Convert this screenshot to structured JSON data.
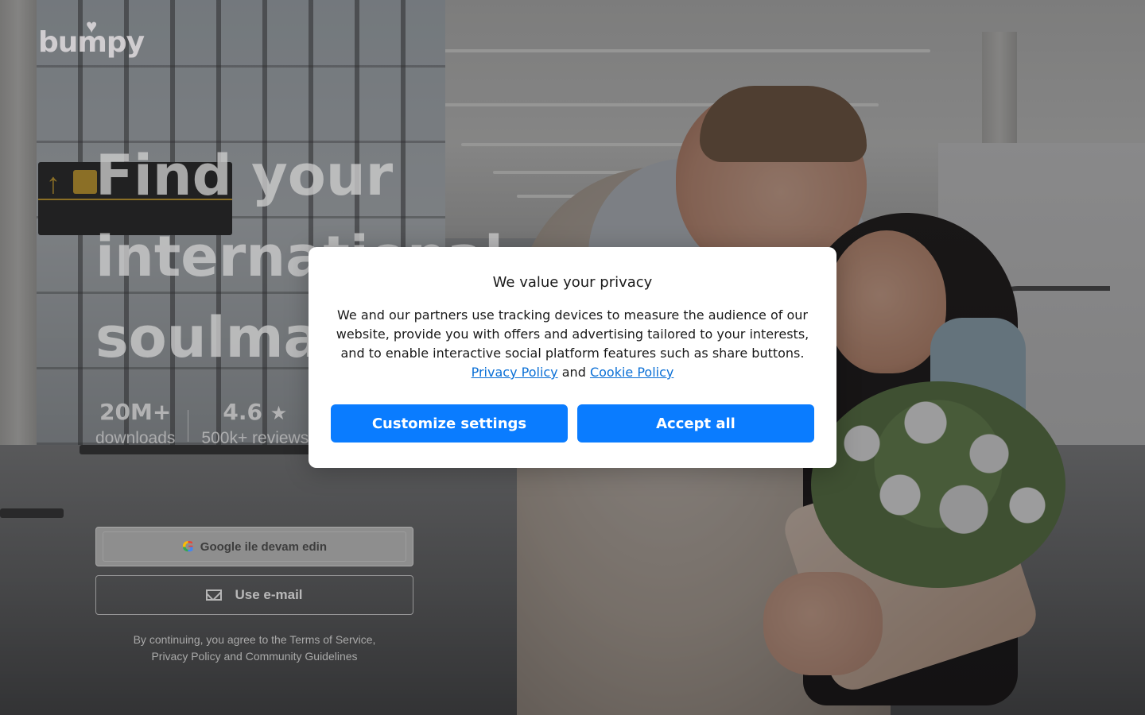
{
  "brand": {
    "logo_text": "bumpy"
  },
  "hero": {
    "title": "Find your international soulmate"
  },
  "stats": [
    {
      "value": "20M+",
      "label": "downloads"
    },
    {
      "value": "4.6",
      "label": "500k+ reviews",
      "icon": "star-icon"
    }
  ],
  "auth": {
    "google_label": "Google ile devam edin",
    "email_label": "Use e-mail",
    "terms_line1": "By continuing, you agree to the Terms of Service,",
    "terms_line2": "Privacy Policy and Community Guidelines"
  },
  "cookie_modal": {
    "title": "We value your privacy",
    "body": "We and our partners use tracking devices to measure the audience of our website, provide you with offers and advertising tailored to your interests, and to enable interactive social platform features such as share buttons.",
    "privacy_link": "Privacy Policy",
    "and_text": "and",
    "cookie_link": "Cookie Policy",
    "customize_label": "Customize settings",
    "accept_label": "Accept all"
  },
  "colors": {
    "accent": "#0a7cff",
    "link": "#0a6fd6"
  }
}
